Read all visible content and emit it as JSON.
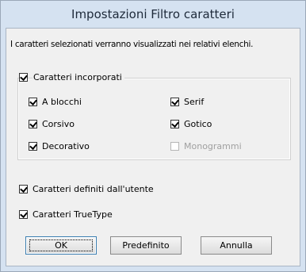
{
  "window": {
    "title": "Impostazioni Filtro caratteri"
  },
  "intro_text": "I caratteri selezionati verranno visualizzati nei relativi elenchi.",
  "embedded_group": {
    "label": "Caratteri incorporati",
    "checked": true,
    "options": [
      {
        "label": "A blocchi",
        "checked": true,
        "enabled": true
      },
      {
        "label": "Serif",
        "checked": true,
        "enabled": true
      },
      {
        "label": "Corsivo",
        "checked": true,
        "enabled": true
      },
      {
        "label": "Gotico",
        "checked": true,
        "enabled": true
      },
      {
        "label": "Decorativo",
        "checked": true,
        "enabled": true
      },
      {
        "label": "Monogrammi",
        "checked": false,
        "enabled": false
      }
    ]
  },
  "user_defined": {
    "label": "Caratteri definiti dall'utente",
    "checked": true
  },
  "truetype": {
    "label": "Caratteri TrueType",
    "checked": true
  },
  "buttons": {
    "ok": "OK",
    "default": "Predefinito",
    "cancel": "Annulla"
  }
}
